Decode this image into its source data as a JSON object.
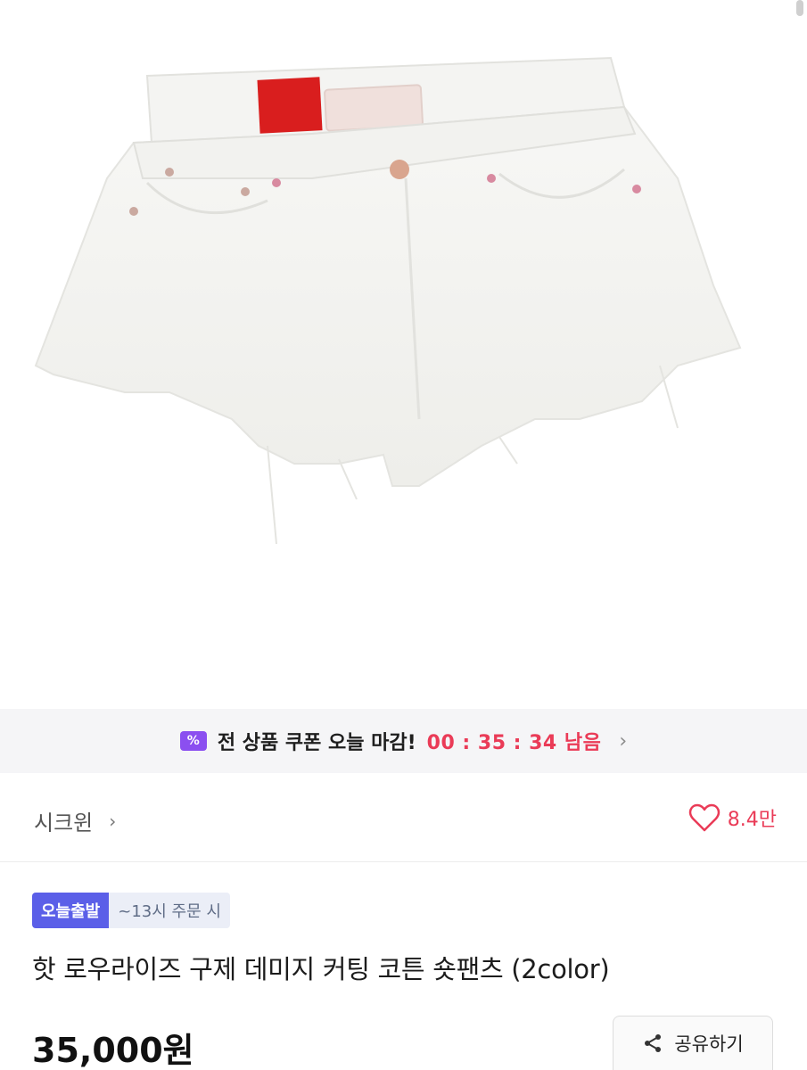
{
  "coupon_banner": {
    "icon": "percent-coupon-icon",
    "text": "전 상품 쿠폰 오늘 마감!",
    "timer": "00 : 35 : 34 남음",
    "timer_color": "#ea3b57",
    "icon_color": "#8b4ff0"
  },
  "seller": {
    "name": "시크윈",
    "chevron": "›"
  },
  "like": {
    "icon": "heart-icon",
    "count": "8.4만",
    "color": "#ea3b57"
  },
  "badges": {
    "primary": "오늘출발",
    "secondary": "~13시 주문 시",
    "primary_color": "#5b5fe8"
  },
  "product": {
    "title": "핫 로우라이즈 구제 데미지 커팅 코튼 숏팬츠 (2color)",
    "price": "35,000원"
  },
  "share": {
    "label": "공유하기",
    "icon": "share-icon"
  },
  "coupon_chevron": "›"
}
